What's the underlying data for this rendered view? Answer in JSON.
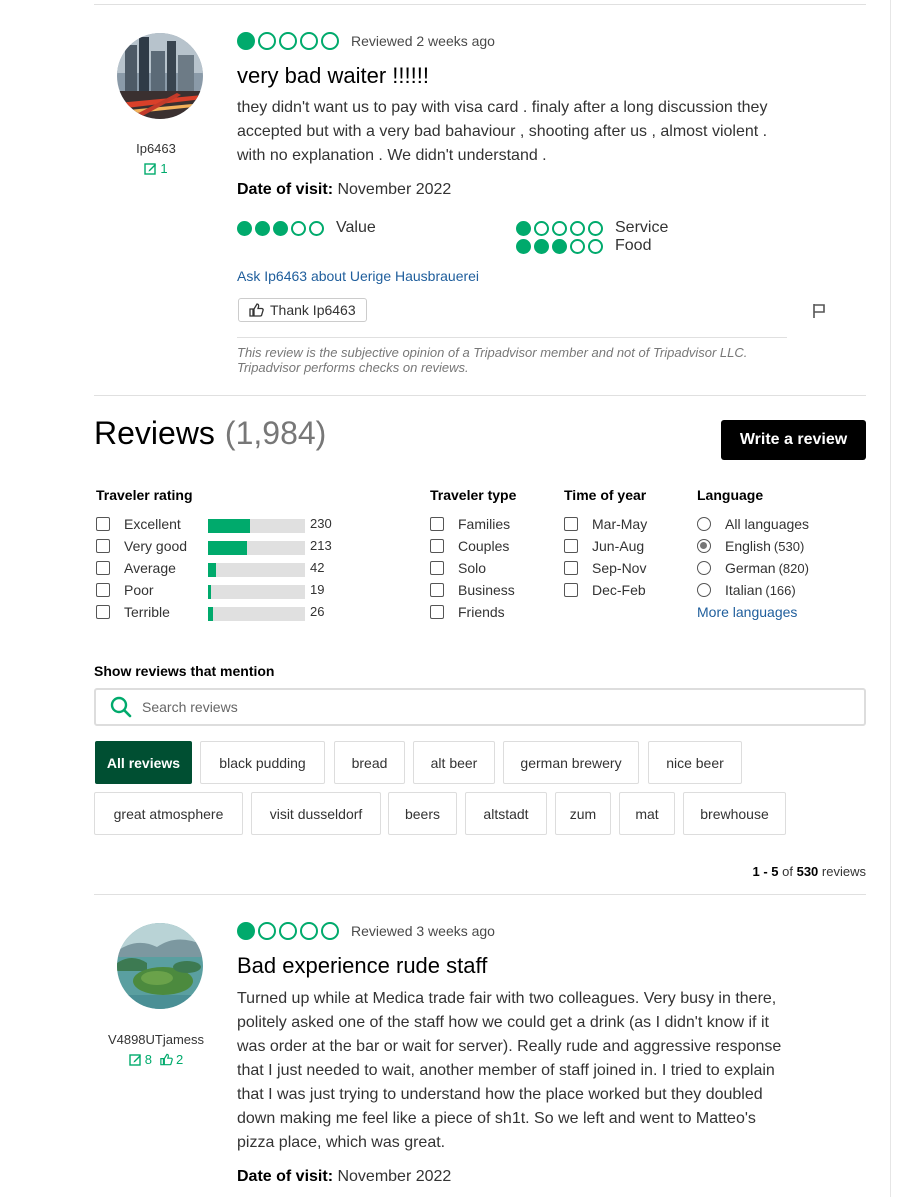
{
  "review1": {
    "reviewer_name": "Ip6463",
    "contributions": "1",
    "rating": 1,
    "reviewed": "Reviewed 2 weeks ago",
    "title": "very bad waiter !!!!!!",
    "body": "they didn't want us to pay with visa card . finaly after a long discussion they accepted but with a very bad bahaviour , shooting after us , almost violent . with no explanation . We didn't understand .",
    "visit_label": "Date of visit:",
    "visit_date": "November 2022",
    "subratings": [
      {
        "label": "Value",
        "rating": 3
      },
      {
        "label": "Service",
        "rating": 1
      },
      {
        "label": "Food",
        "rating": 3
      }
    ],
    "ask_link": "Ask Ip6463 about Uerige Hausbrauerei",
    "thank_label": "Thank Ip6463",
    "disclaimer": "This review is the subjective opinion of a Tripadvisor member and not of Tripadvisor LLC. Tripadvisor performs checks on reviews."
  },
  "reviews_header": {
    "title": "Reviews",
    "count": "(1,984)",
    "write_label": "Write a review"
  },
  "filters": {
    "traveler_rating": {
      "heading": "Traveler rating",
      "items": [
        {
          "label": "Excellent",
          "count": "230",
          "fraction": 0.432
        },
        {
          "label": "Very good",
          "count": "213",
          "fraction": 0.4
        },
        {
          "label": "Average",
          "count": "42",
          "fraction": 0.079
        },
        {
          "label": "Poor",
          "count": "19",
          "fraction": 0.036
        },
        {
          "label": "Terrible",
          "count": "26",
          "fraction": 0.049
        }
      ]
    },
    "traveler_type": {
      "heading": "Traveler type",
      "items": [
        "Families",
        "Couples",
        "Solo",
        "Business",
        "Friends"
      ]
    },
    "time_of_year": {
      "heading": "Time of year",
      "items": [
        "Mar-May",
        "Jun-Aug",
        "Sep-Nov",
        "Dec-Feb"
      ]
    },
    "language": {
      "heading": "Language",
      "items": [
        {
          "label": "All languages",
          "count": "",
          "checked": false
        },
        {
          "label": "English",
          "count": "(530)",
          "checked": true
        },
        {
          "label": "German",
          "count": "(820)",
          "checked": false
        },
        {
          "label": "Italian",
          "count": "(166)",
          "checked": false
        }
      ],
      "more": "More languages"
    }
  },
  "mentions": {
    "label": "Show reviews that mention",
    "search_placeholder": "Search reviews",
    "chips_row1": [
      "All reviews",
      "black pudding",
      "bread",
      "alt beer",
      "german brewery",
      "nice beer"
    ],
    "chips_row2": [
      "great atmosphere",
      "visit dusseldorf",
      "beers",
      "altstadt",
      "zum",
      "mat",
      "brewhouse"
    ]
  },
  "pagination": {
    "range": "1 - 5",
    "of": "of",
    "total": "530",
    "suffix": "reviews"
  },
  "review2": {
    "reviewer_name": "V4898UTjamess",
    "contributions": "8",
    "helpful": "2",
    "rating": 1,
    "reviewed": "Reviewed 3 weeks ago",
    "title": "Bad experience rude staff",
    "body": "Turned up while at Medica trade fair with two colleagues. Very busy in there, politely asked one of the staff how we could get a drink (as I didn't know if it was order at the bar or wait for server). Really rude and aggressive response that I just needed to wait, another member of staff joined in. I tried to explain that I was just trying to understand how the place worked but they doubled down making me feel like a piece of sh1t. So we left and went to Matteo's pizza place, which was great.",
    "visit_label": "Date of visit:",
    "visit_date": "November 2022"
  },
  "colors": {
    "accent": "#00aa6c",
    "chip_active": "#004f32",
    "link": "#1f5e9c"
  }
}
